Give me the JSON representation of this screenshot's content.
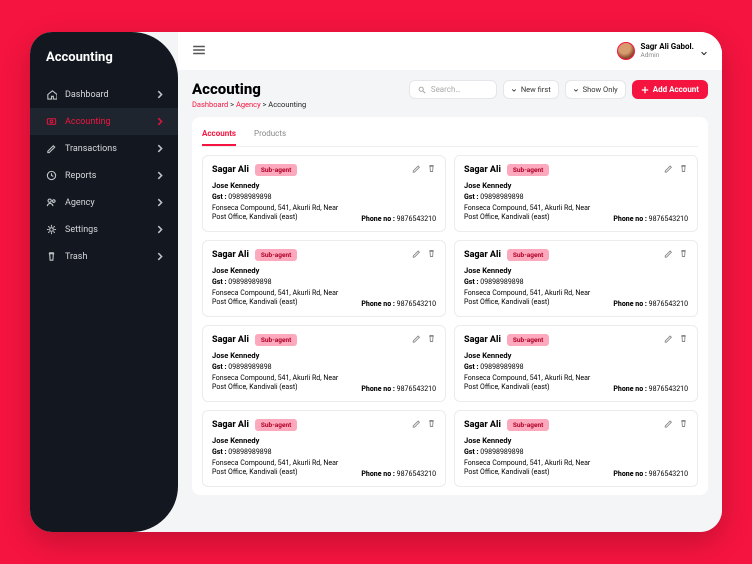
{
  "app": {
    "logo": "Accounting"
  },
  "sidebar": {
    "items": [
      {
        "label": "Dashboard",
        "icon": "home"
      },
      {
        "label": "Accounting",
        "icon": "camera",
        "active": true
      },
      {
        "label": "Transactions",
        "icon": "edit"
      },
      {
        "label": "Reports",
        "icon": "clock"
      },
      {
        "label": "Agency",
        "icon": "users"
      },
      {
        "label": "Settings",
        "icon": "gear"
      },
      {
        "label": "Trash",
        "icon": "trash"
      }
    ]
  },
  "topbar": {
    "user_name": "Sagr Ali Gabol.",
    "user_role": "Admin"
  },
  "page": {
    "title": "Accouting",
    "crumbs": [
      {
        "label": "Dashboard",
        "link": true
      },
      {
        "label": "Agency",
        "link": true
      },
      {
        "label": "Accounting",
        "link": false
      }
    ],
    "search_placeholder": "Search…",
    "sort_label": "New first",
    "filter_label": "Show Only",
    "add_label": "Add Account"
  },
  "tabs": [
    {
      "label": "Accounts",
      "active": true
    },
    {
      "label": "Products",
      "active": false
    }
  ],
  "card_template": {
    "name": "Sagar Ali",
    "badge": "Sub-agent",
    "subtitle": "Jose Kennedy",
    "gst_label": "Gst :",
    "gst": "09898989898",
    "address": "Fonseca Compound, 541, Akurli Rd, Near Post Office, Kandivali (east)",
    "phone_label": "Phone no :",
    "phone": "9876543210"
  },
  "card_count": 8,
  "colors": {
    "accent": "#f5143f",
    "dark": "#131820",
    "badge": "#fda9bd"
  }
}
